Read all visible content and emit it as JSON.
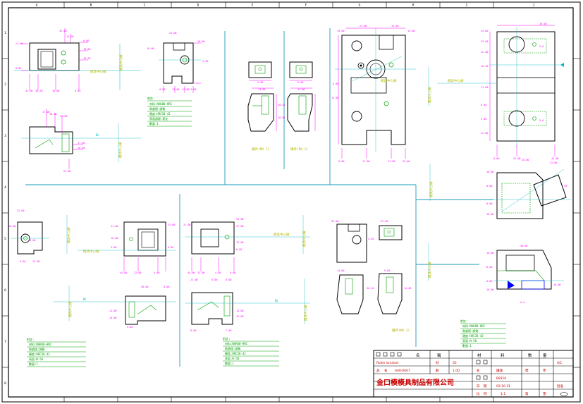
{
  "frame": {
    "col_labels": [
      "A",
      "B",
      "C",
      "D",
      "E",
      "F",
      "G",
      "H",
      "I",
      "J"
    ],
    "row_labels": [
      "1",
      "2",
      "3",
      "4",
      "5",
      "6",
      "7",
      "8"
    ]
  },
  "view_labels": {
    "top_left_1": "模具中心線",
    "top_left_2": "模具中心線",
    "top_left_3": "模具中心線",
    "section_1": "鑲件(NO 1)",
    "section_2": "鑲件(NO 2)",
    "mid_center": "模具中心線",
    "bottom_center_1": "模具中心線",
    "bottom_center_2": "模具中心線",
    "bottom_right_caption": "鑲件(NO 3)",
    "right_label_1": "模具中心線",
    "right_label_2": "模具中心線",
    "right_label_3": "模具中心線",
    "right_mid": "模具中心線"
  },
  "note_blocks": [
    {
      "title": "附註:",
      "lines": [
        "材料:NAK80-HRC",
        "熱處理:調質",
        "硬度:HRC38-42",
        "表面處理:氮化",
        "數量:1"
      ]
    },
    {
      "title": "附註:",
      "lines": [
        "材料:NAK80-HRC",
        "熱處理:調質",
        "硬度:HRC38-42",
        "表面:N-50",
        "數量:1"
      ]
    },
    {
      "title": "附註:",
      "lines": [
        "材料:NAK80-HRC",
        "熱處理:調質",
        "硬度:HRC38-42",
        "表面:N-50",
        "數量:1"
      ]
    },
    {
      "title": "附註:",
      "lines": [
        "材料:NAK80-HRC",
        "熱處理:調質",
        "硬度:HRC38-42",
        "表面:N-50",
        "數量:1"
      ]
    }
  ],
  "title_block": {
    "row1": [
      "名",
      "稱",
      "材",
      "料",
      "數",
      "量",
      "圖",
      "號"
    ],
    "customer_label": "Roller bracket",
    "material_label": "材",
    "material_value": "S5",
    "part_label": "品",
    "part_value": "名",
    "part_no": "A00-0007",
    "qty_label": "數",
    "qty_value": "1.00",
    "name_label": "名",
    "name_value": "鑲塊",
    "std_label": "標",
    "std_value": "準",
    "company": "金口模模具制品有限公司",
    "date_label": "日",
    "date_label2": "期",
    "date_value": "02.10.31",
    "scale_label": "比",
    "scale_label2": "例",
    "scale_value": "1:1",
    "sheet_label": "第",
    "sheet_value": "張",
    "approved": "批准",
    "drawing_no": "B8101",
    "rev": "0/1",
    "designer": "設計",
    "checker": "審核"
  },
  "colors": {
    "frame": "#000000",
    "part_outline": "#000000",
    "dimension": "#ff00ff",
    "center_line": "#00b7c3",
    "text_green": "#00a000",
    "label_yellow": "#b8b800",
    "hidden": "#00a000",
    "section_line": "#1a9ab8",
    "title_red": "#cc0000",
    "blue": "#0000ff"
  }
}
